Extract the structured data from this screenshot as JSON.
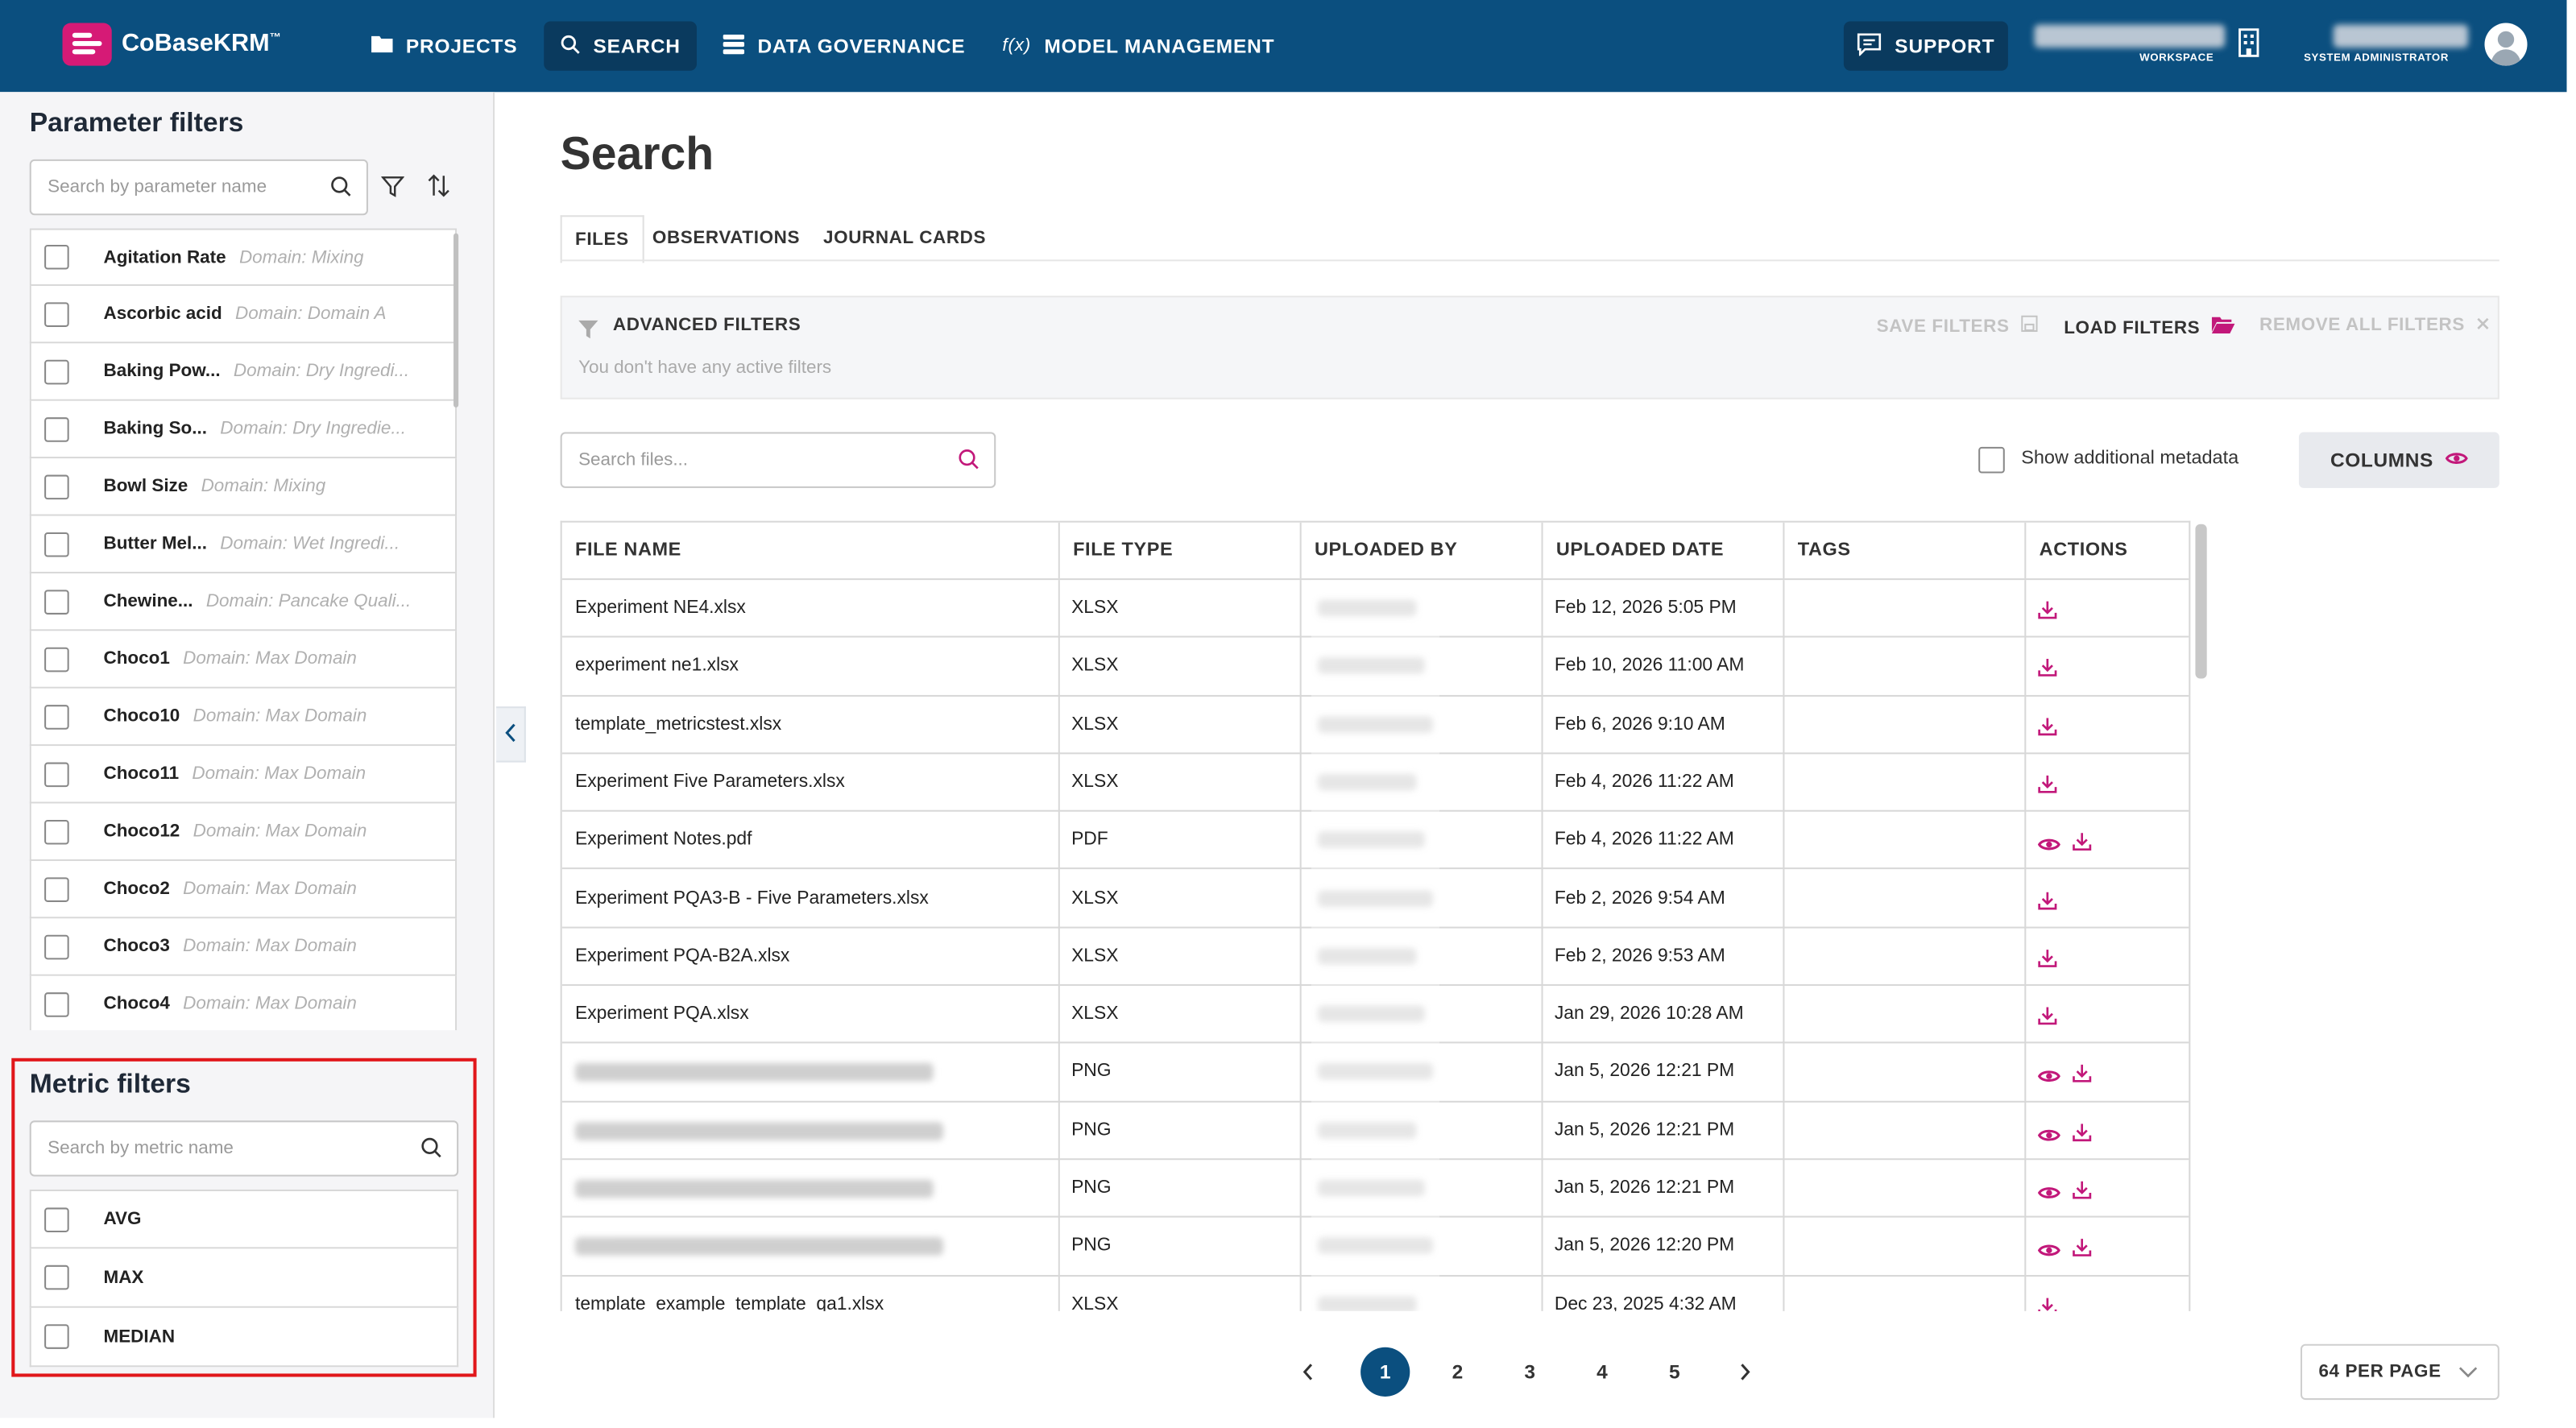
{
  "app": {
    "name": "CoBaseKRM",
    "tm": "™"
  },
  "nav": {
    "projects": "PROJECTS",
    "search": "SEARCH",
    "data_governance": "DATA GOVERNANCE",
    "fx_symbol": "f(x)",
    "model_management": "MODEL MANAGEMENT",
    "support": "SUPPORT",
    "workspace_caption": "WORKSPACE",
    "role_caption": "SYSTEM ADMINISTRATOR"
  },
  "parameter_filters": {
    "title": "Parameter filters",
    "search_placeholder": "Search by parameter name",
    "items": [
      {
        "name": "Agitation Rate",
        "domain": "Domain: Mixing"
      },
      {
        "name": "Ascorbic acid",
        "domain": "Domain: Domain A"
      },
      {
        "name": "Baking Pow...",
        "domain": "Domain: Dry Ingredi..."
      },
      {
        "name": "Baking So...",
        "domain": "Domain: Dry Ingredie..."
      },
      {
        "name": "Bowl Size",
        "domain": "Domain: Mixing"
      },
      {
        "name": "Butter Mel...",
        "domain": "Domain: Wet Ingredi..."
      },
      {
        "name": "Chewine...",
        "domain": "Domain: Pancake Quali..."
      },
      {
        "name": "Choco1",
        "domain": "Domain: Max Domain"
      },
      {
        "name": "Choco10",
        "domain": "Domain: Max Domain"
      },
      {
        "name": "Choco11",
        "domain": "Domain: Max Domain"
      },
      {
        "name": "Choco12",
        "domain": "Domain: Max Domain"
      },
      {
        "name": "Choco2",
        "domain": "Domain: Max Domain"
      },
      {
        "name": "Choco3",
        "domain": "Domain: Max Domain"
      },
      {
        "name": "Choco4",
        "domain": "Domain: Max Domain"
      }
    ]
  },
  "metric_filters": {
    "title": "Metric filters",
    "search_placeholder": "Search by metric name",
    "items": [
      "AVG",
      "MAX",
      "MEDIAN"
    ]
  },
  "main": {
    "title": "Search",
    "tabs": [
      "FILES",
      "OBSERVATIONS",
      "JOURNAL CARDS"
    ],
    "advanced_filters": {
      "label": "ADVANCED FILTERS",
      "empty_text": "You don't have any active filters",
      "save": "SAVE FILTERS",
      "load": "LOAD FILTERS",
      "remove": "REMOVE ALL FILTERS"
    },
    "search_placeholder": "Search files...",
    "show_metadata_label": "Show additional metadata",
    "columns_button": "COLUMNS"
  },
  "table": {
    "headers": [
      "FILE NAME",
      "FILE TYPE",
      "UPLOADED BY",
      "UPLOADED DATE",
      "TAGS",
      "ACTIONS"
    ],
    "rows": [
      {
        "file": "Experiment NE4.xlsx",
        "type": "XLSX",
        "date": "Feb 12, 2026 5:05 PM",
        "view": false
      },
      {
        "file": "experiment ne1.xlsx",
        "type": "XLSX",
        "date": "Feb 10, 2026 11:00 AM",
        "view": false
      },
      {
        "file": "template_metricstest.xlsx",
        "type": "XLSX",
        "date": "Feb 6, 2026 9:10 AM",
        "view": false
      },
      {
        "file": "Experiment Five Parameters.xlsx",
        "type": "XLSX",
        "date": "Feb 4, 2026 11:22 AM",
        "view": false
      },
      {
        "file": "Experiment Notes.pdf",
        "type": "PDF",
        "date": "Feb 4, 2026 11:22 AM",
        "view": true
      },
      {
        "file": "Experiment PQA3-B - Five Parameters.xlsx",
        "type": "XLSX",
        "date": "Feb 2, 2026 9:54 AM",
        "view": false
      },
      {
        "file": "Experiment PQA-B2A.xlsx",
        "type": "XLSX",
        "date": "Feb 2, 2026 9:53 AM",
        "view": false
      },
      {
        "file": "Experiment PQA.xlsx",
        "type": "XLSX",
        "date": "Jan 29, 2026 10:28 AM",
        "view": false
      },
      {
        "file": "",
        "type": "PNG",
        "date": "Jan 5, 2026 12:21 PM",
        "view": true
      },
      {
        "file": "",
        "type": "PNG",
        "date": "Jan 5, 2026 12:21 PM",
        "view": true
      },
      {
        "file": "",
        "type": "PNG",
        "date": "Jan 5, 2026 12:21 PM",
        "view": true
      },
      {
        "file": "",
        "type": "PNG",
        "date": "Jan 5, 2026 12:20 PM",
        "view": true
      },
      {
        "file": "template_example_template_qa1.xlsx",
        "type": "XLSX",
        "date": "Dec 23, 2025 4:32 AM",
        "view": false
      }
    ]
  },
  "pagination": {
    "pages": [
      "1",
      "2",
      "3",
      "4",
      "5"
    ],
    "current": "1",
    "per_page": "64 PER PAGE"
  },
  "colors": {
    "brand": "#0b4f7f",
    "accent": "#c2187a",
    "highlight": "#e1171b"
  }
}
